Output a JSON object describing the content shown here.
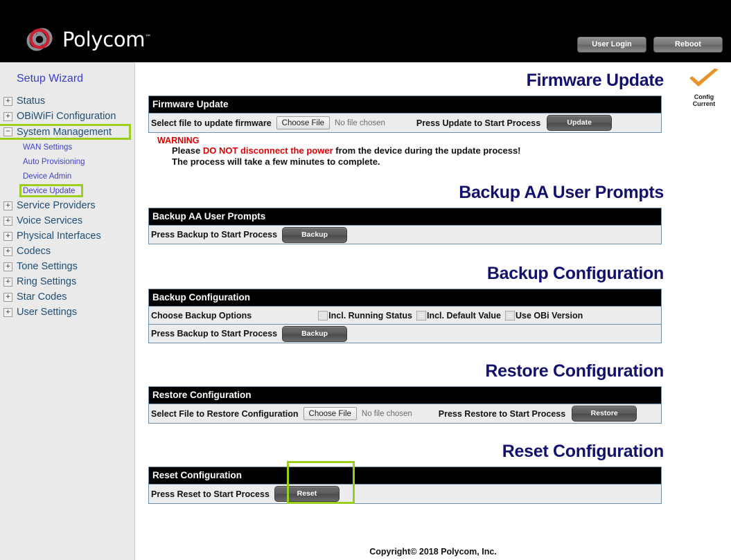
{
  "header": {
    "brand": "Polycom",
    "brand_tm": "™",
    "buttons": [
      {
        "label": "User Login",
        "name": "user-login-button"
      },
      {
        "label": "Reboot",
        "name": "reboot-button"
      }
    ]
  },
  "sidebar": {
    "setup_wizard": "Setup Wizard",
    "top_items": [
      {
        "label": "Status",
        "expander": "+"
      },
      {
        "label": "OBiWiFi Configuration",
        "expander": "+"
      },
      {
        "label": "System Management",
        "expander": "−"
      },
      {
        "label": "Service Providers",
        "expander": "+"
      },
      {
        "label": "Voice Services",
        "expander": "+"
      },
      {
        "label": "Physical Interfaces",
        "expander": "+"
      },
      {
        "label": "Codecs",
        "expander": "+"
      },
      {
        "label": "Tone Settings",
        "expander": "+"
      },
      {
        "label": "Ring Settings",
        "expander": "+"
      },
      {
        "label": "Star Codes",
        "expander": "+"
      },
      {
        "label": "User Settings",
        "expander": "+"
      }
    ],
    "sub_items": [
      {
        "label": "WAN Settings"
      },
      {
        "label": "Auto Provisioning"
      },
      {
        "label": "Device Admin"
      },
      {
        "label": "Device Update"
      }
    ]
  },
  "status_badge": {
    "line1": "Config",
    "line2": "Current",
    "color": "#E8922C"
  },
  "sections": {
    "firmware": {
      "title": "Firmware Update",
      "panel_head": "Firmware Update",
      "row_label": "Select file to update firmware",
      "choose_file": "Choose File",
      "no_file": "No file chosen",
      "press_label": "Press Update to Start Process",
      "button": "Update",
      "warning_title": "WARNING",
      "warning_line1_a": "Please ",
      "warning_line1_b": "DO NOT disconnect the power",
      "warning_line1_c": " from the device during the update process!",
      "warning_line2": "The process will take a few minutes to complete."
    },
    "backup_aa": {
      "title": "Backup AA User Prompts",
      "panel_head": "Backup AA User Prompts",
      "row_label": "Press Backup to Start Process",
      "button": "Backup"
    },
    "backup_config": {
      "title": "Backup Configuration",
      "panel_head": "Backup Configuration",
      "options_label": "Choose Backup Options",
      "options": [
        {
          "label": "Incl. Running Status",
          "checked": false
        },
        {
          "label": "Incl. Default Value",
          "checked": false
        },
        {
          "label": "Use OBi Version",
          "checked": false
        }
      ],
      "row_label": "Press Backup to Start Process",
      "button": "Backup"
    },
    "restore_config": {
      "title": "Restore Configuration",
      "panel_head": "Restore Configuration",
      "row_label": "Select File to Restore Configuration",
      "choose_file": "Choose File",
      "no_file": "No file chosen",
      "press_label": "Press Restore to Start Process",
      "button": "Restore"
    },
    "reset_config": {
      "title": "Reset Configuration",
      "panel_head": "Reset Configuration",
      "row_label": "Press Reset to Start Process",
      "button": "Reset"
    }
  },
  "footer": {
    "copyright": "Copyright© 2018 Polycom, Inc."
  },
  "highlight": {
    "color": "#9ACD1E"
  }
}
